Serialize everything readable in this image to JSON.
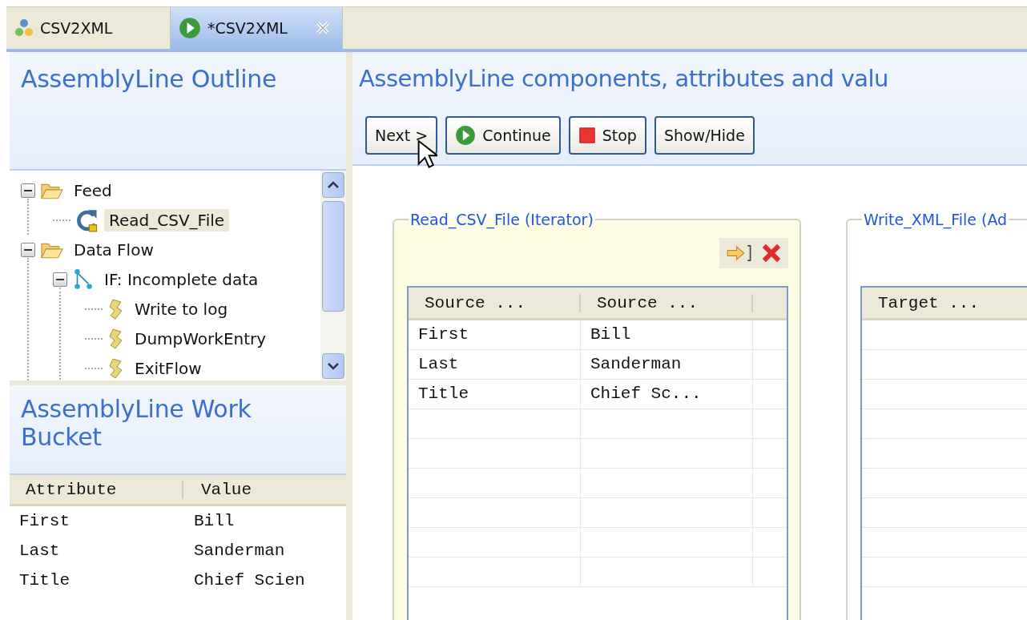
{
  "tabs": [
    {
      "label": "CSV2XML",
      "kind": "config",
      "selected": false,
      "closable": false
    },
    {
      "label": "*CSV2XML",
      "kind": "run",
      "selected": true,
      "closable": true
    }
  ],
  "outline": {
    "title": "AssemblyLine Outline",
    "tree": [
      {
        "label": "Feed",
        "kind": "folder",
        "selected": false,
        "expanded": true,
        "children": [
          {
            "label": "Read_CSV_File",
            "kind": "iterator",
            "selected": true
          }
        ]
      },
      {
        "label": "Data Flow",
        "kind": "folder",
        "selected": false,
        "expanded": true,
        "children": [
          {
            "label": "IF: Incomplete data",
            "kind": "branch",
            "selected": false,
            "expanded": true,
            "children": [
              {
                "label": "Write to log",
                "kind": "script",
                "selected": false
              },
              {
                "label": "DumpWorkEntry",
                "kind": "script",
                "selected": false
              },
              {
                "label": "ExitFlow",
                "kind": "script",
                "selected": false
              }
            ]
          }
        ]
      }
    ]
  },
  "work_bucket": {
    "title": "AssemblyLine Work Bucket",
    "columns": [
      "Attribute",
      "Value"
    ],
    "rows": [
      [
        "First",
        "Bill"
      ],
      [
        "Last",
        "Sanderman"
      ],
      [
        "Title",
        "Chief Scien"
      ]
    ]
  },
  "main": {
    "title": "AssemblyLine components, attributes and valu",
    "buttons": [
      {
        "label": "Next >",
        "kind": "plain"
      },
      {
        "label": "Continue",
        "kind": "run"
      },
      {
        "label": "Stop",
        "kind": "stop"
      },
      {
        "label": "Show/Hide",
        "kind": "plain"
      }
    ],
    "components": [
      {
        "title": "Read_CSV_File (Iterator)",
        "highlighted": true,
        "toolbar": true,
        "columns": [
          "Source ...",
          "Source ..."
        ],
        "rows": [
          [
            "First",
            "Bill"
          ],
          [
            "Last",
            "Sanderman"
          ],
          [
            "Title",
            "Chief Sc..."
          ]
        ]
      },
      {
        "title": "Write_XML_File (Ad",
        "highlighted": false,
        "toolbar": false,
        "columns": [
          "Target ..."
        ]
      }
    ]
  }
}
